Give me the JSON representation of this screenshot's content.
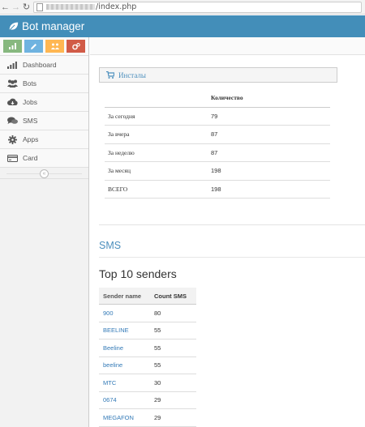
{
  "browser": {
    "url_suffix": "/index.php"
  },
  "app": {
    "brand": "Bot manager"
  },
  "shortcuts": [
    {
      "name": "chart-icon",
      "color": "#87b87f"
    },
    {
      "name": "pencil-icon",
      "color": "#6fb3e0"
    },
    {
      "name": "users-icon",
      "color": "#ffb752"
    },
    {
      "name": "cogs-icon",
      "color": "#d15b47"
    }
  ],
  "sidebar": {
    "items": [
      {
        "label": "Dashboard",
        "icon": "dashboard-icon"
      },
      {
        "label": "Bots",
        "icon": "group-icon"
      },
      {
        "label": "Jobs",
        "icon": "cloud-download-icon"
      },
      {
        "label": "SMS",
        "icon": "comments-icon"
      },
      {
        "label": "Apps",
        "icon": "gear-icon"
      },
      {
        "label": "Card",
        "icon": "credit-card-icon"
      }
    ],
    "collapse_glyph": "«"
  },
  "installs": {
    "title": "Инсталы",
    "header": {
      "label": "",
      "count": "Количество"
    },
    "rows": [
      {
        "label": "За сегодня",
        "value": "79"
      },
      {
        "label": "За вчера",
        "value": "87"
      },
      {
        "label": "За неделю",
        "value": "87"
      },
      {
        "label": "За месяц",
        "value": "198"
      },
      {
        "label": "ВСЕГО",
        "value": "198"
      }
    ]
  },
  "sms": {
    "section_title": "SMS",
    "top_title": "Top 10 senders",
    "columns": {
      "name": "Sender name",
      "count": "Count SMS"
    },
    "rows": [
      {
        "name": "900",
        "count": "80"
      },
      {
        "name": "BEELINE",
        "count": "55"
      },
      {
        "name": "Beeline",
        "count": "55"
      },
      {
        "name": "beeline",
        "count": "55"
      },
      {
        "name": "MTC",
        "count": "30"
      },
      {
        "name": "0674",
        "count": "29"
      },
      {
        "name": "MEGAFON",
        "count": "29"
      }
    ]
  },
  "colors": {
    "header": "#438eb9",
    "link": "#337ab7",
    "accent": "#4c8fbd"
  }
}
